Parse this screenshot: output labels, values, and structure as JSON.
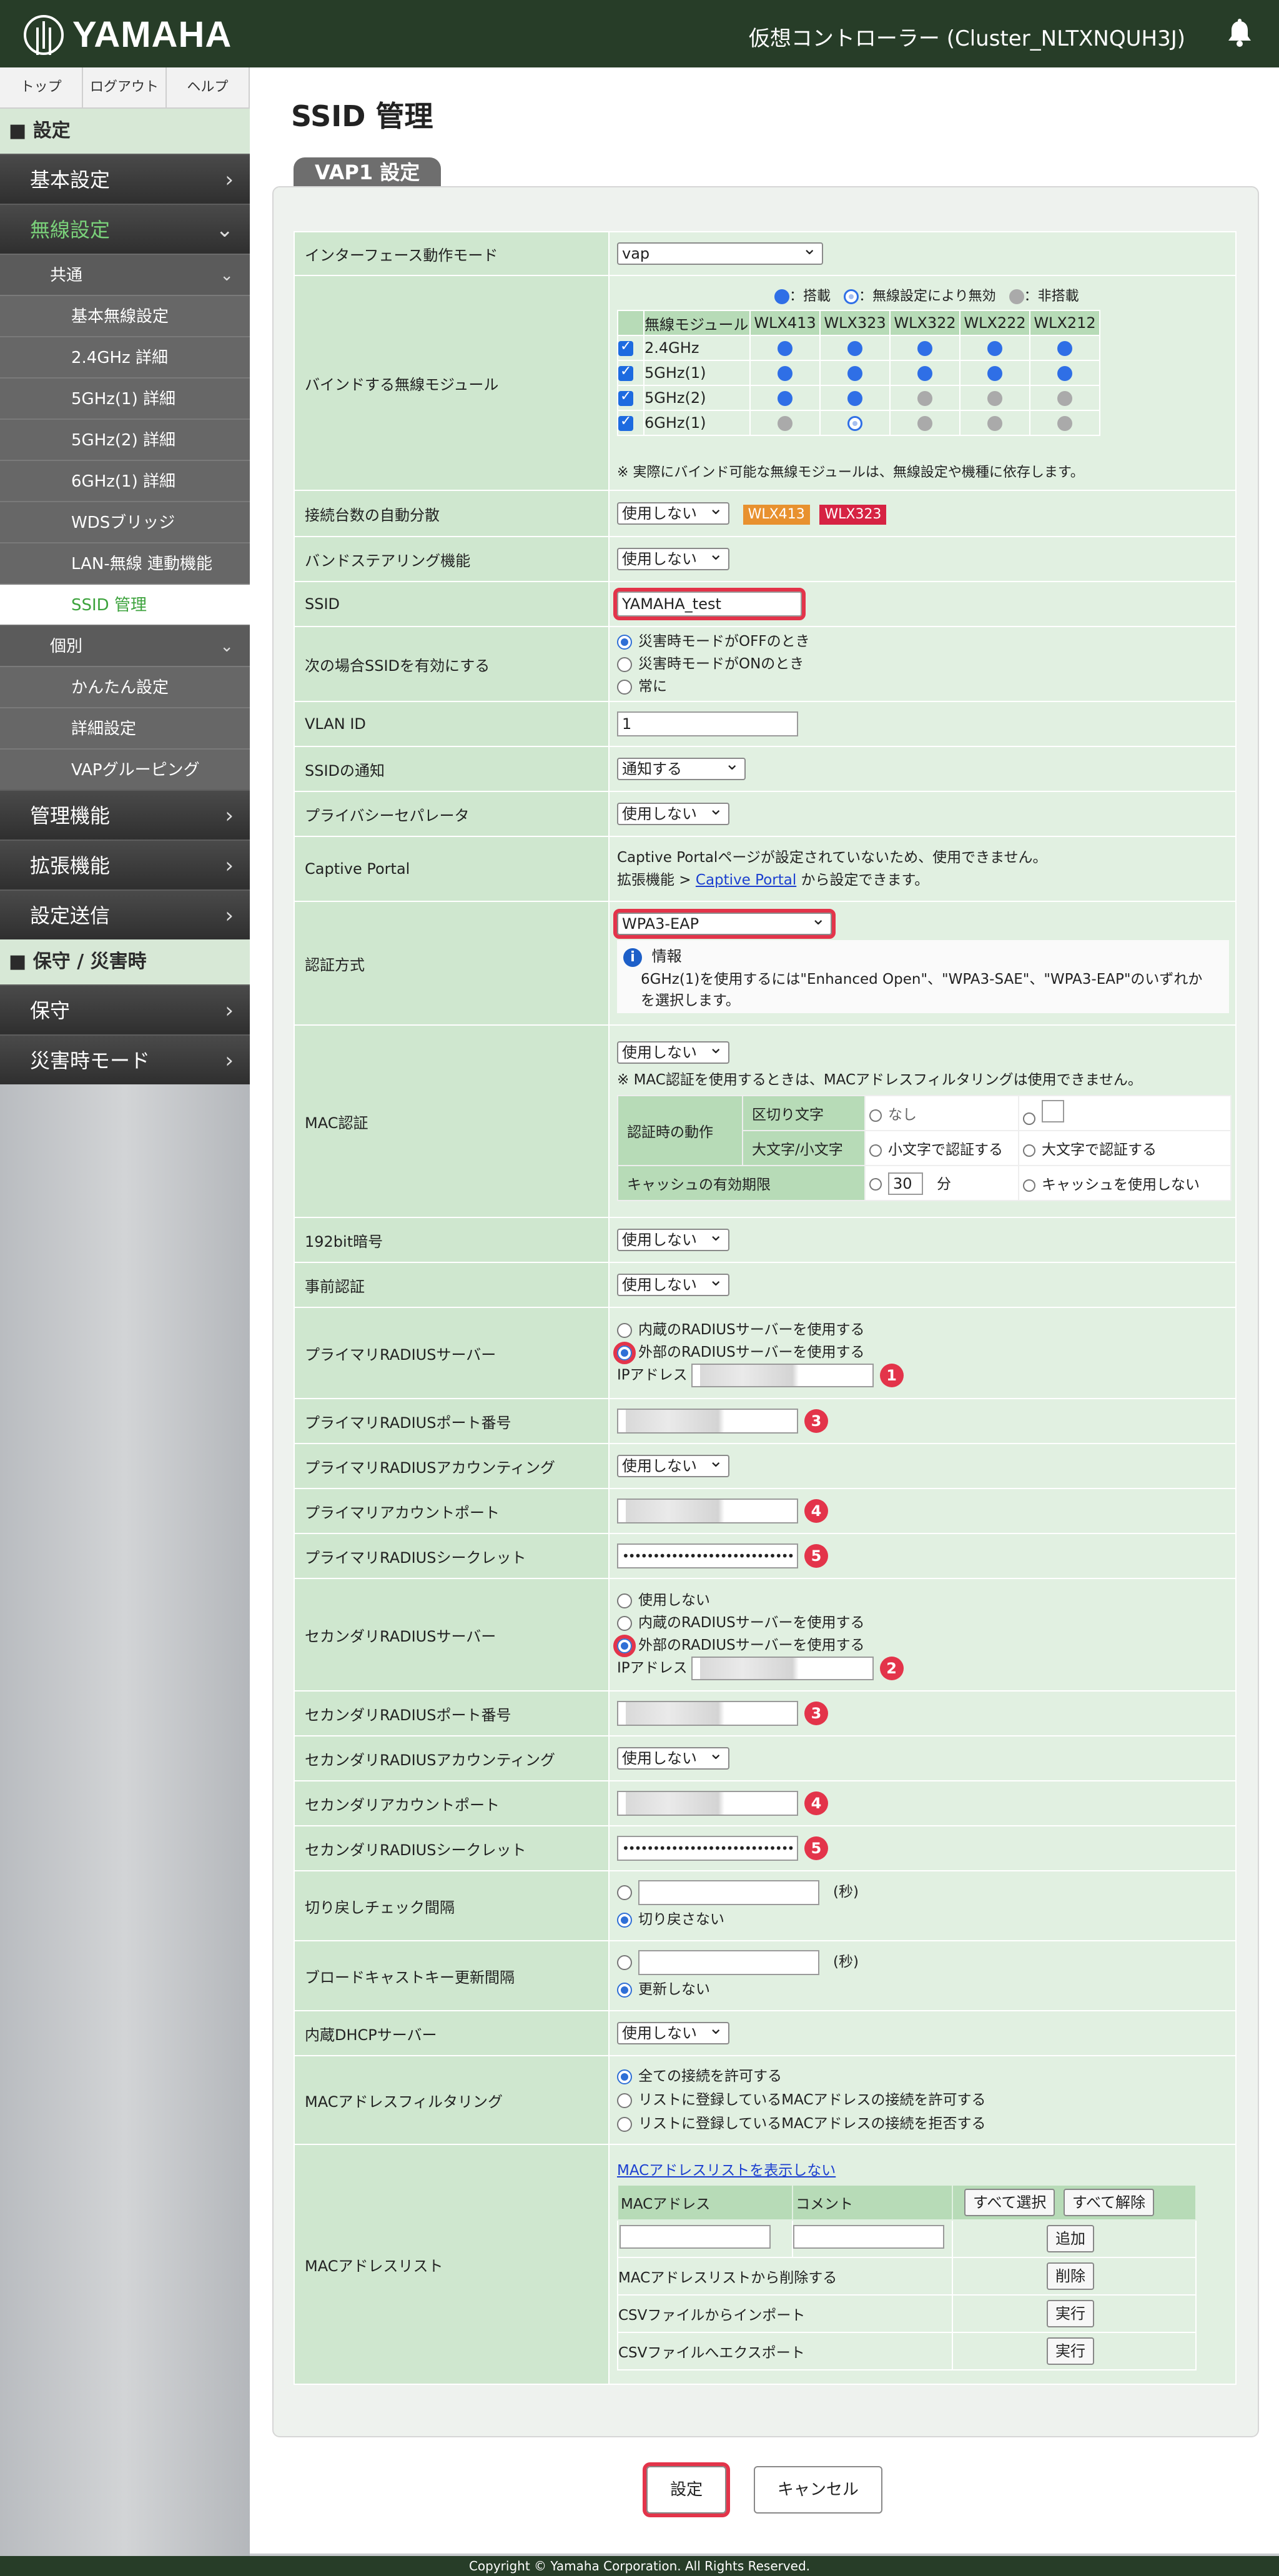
{
  "header": {
    "logo_text": "YAMAHA",
    "controller_title": "仮想コントローラー (Cluster_NLTXNQUH3J)",
    "bell_icon": "bell-icon"
  },
  "sidebar": {
    "top_links": [
      "トップ",
      "ログアウト",
      "ヘルプ"
    ],
    "cat_settings": "設定",
    "basic": "基本設定",
    "wireless": "無線設定",
    "common": "共通",
    "common_items": [
      "基本無線設定",
      "2.4GHz 詳細",
      "5GHz(1) 詳細",
      "5GHz(2) 詳細",
      "6GHz(1) 詳細",
      "WDSブリッジ",
      "LAN-無線 連動機能",
      "SSID 管理"
    ],
    "individual": "個別",
    "individual_items": [
      "かんたん設定",
      "詳細設定",
      "VAPグルーピング"
    ],
    "mgmt": "管理機能",
    "ext": "拡張機能",
    "send": "設定送信",
    "cat_maint": "保守 / 災害時",
    "maint": "保守",
    "disaster": "災害時モード"
  },
  "page": {
    "title": "SSID 管理",
    "tab": "VAP1 設定"
  },
  "form": {
    "iface_mode": {
      "label": "インターフェース動作モード",
      "value": "vap"
    },
    "bind": {
      "label": "バインドする無線モジュール",
      "legend_on": "：搭載",
      "legend_disabled": "：無線設定により無効",
      "legend_off": "：非搭載",
      "col_module": "無線モジュール",
      "models": [
        "WLX413",
        "WLX323",
        "WLX322",
        "WLX222",
        "WLX212"
      ],
      "rows": [
        {
          "name": "2.4GHz",
          "states": [
            "on",
            "on",
            "on",
            "on",
            "on"
          ]
        },
        {
          "name": "5GHz(1)",
          "states": [
            "on",
            "on",
            "on",
            "on",
            "on"
          ]
        },
        {
          "name": "5GHz(2)",
          "states": [
            "on",
            "on",
            "off",
            "off",
            "off"
          ]
        },
        {
          "name": "6GHz(1)",
          "states": [
            "off",
            "disabled",
            "off",
            "off",
            "off"
          ]
        }
      ],
      "note": "※ 実際にバインド可能な無線モジュールは、無線設定や機種に依存します。"
    },
    "auto_dist": {
      "label": "接続台数の自動分散",
      "value": "使用しない",
      "tag1": "WLX413",
      "tag2": "WLX323"
    },
    "band_steer": {
      "label": "バンドステアリング機能",
      "value": "使用しない"
    },
    "ssid": {
      "label": "SSID",
      "value": "YAMAHA_test"
    },
    "ssid_enable": {
      "label": "次の場合SSIDを有効にする",
      "opt1": "災害時モードがOFFのとき",
      "opt2": "災害時モードがONのとき",
      "opt3": "常に"
    },
    "vlan": {
      "label": "VLAN ID",
      "value": "1"
    },
    "ssid_notify": {
      "label": "SSIDの通知",
      "value": "通知する"
    },
    "privacy": {
      "label": "プライバシーセパレータ",
      "value": "使用しない"
    },
    "captive": {
      "label": "Captive Portal",
      "line1": "Captive Portalページが設定されていないため、使用できません。",
      "line2_prefix": "拡張機能 > ",
      "line2_link": "Captive Portal",
      "line2_suffix": " から設定できます。"
    },
    "auth": {
      "label": "認証方式",
      "value": "WPA3-EAP",
      "info_title": "情報",
      "info_text1": "6GHz(1)を使用するには\"Enhanced Open\"、\"WPA3-SAE\"、\"WPA3-EAP\"のいずれか",
      "info_text2": "を選択します。"
    },
    "mac_auth": {
      "label": "MAC認証",
      "value": "使用しない",
      "note": "※ MAC認証を使用するときは、MACアドレスフィルタリングは使用できません。",
      "action_label": "認証時の動作",
      "delim_label": "区切り文字",
      "delim_opt": "なし",
      "case_label": "大文字/小文字",
      "case_opt1": "小文字で認証する",
      "case_opt2": "大文字で認証する",
      "cache_label": "キャッシュの有効期限",
      "cache_value": "30",
      "cache_unit": "分",
      "cache_opt2": "キャッシュを使用しない"
    },
    "bit192": {
      "label": "192bit暗号",
      "value": "使用しない"
    },
    "preauth": {
      "label": "事前認証",
      "value": "使用しない"
    },
    "primary_radius": {
      "label": "プライマリRADIUSサーバー",
      "opt1": "内蔵のRADIUSサーバーを使用する",
      "opt2": "外部のRADIUSサーバーを使用する",
      "ip_label": "IPアドレス",
      "badge": "1"
    },
    "primary_port": {
      "label": "プライマリRADIUSポート番号",
      "badge": "3"
    },
    "primary_acct": {
      "label": "プライマリRADIUSアカウンティング",
      "value": "使用しない"
    },
    "primary_acct_port": {
      "label": "プライマリアカウントポート",
      "badge": "4"
    },
    "primary_secret": {
      "label": "プライマリRADIUSシークレット",
      "value": "••••••••••••••••••••••••••••",
      "badge": "5"
    },
    "secondary_radius": {
      "label": "セカンダリRADIUSサーバー",
      "opt0": "使用しない",
      "opt1": "内蔵のRADIUSサーバーを使用する",
      "opt2": "外部のRADIUSサーバーを使用する",
      "ip_label": "IPアドレス",
      "badge": "2"
    },
    "secondary_port": {
      "label": "セカンダリRADIUSポート番号",
      "badge": "3"
    },
    "secondary_acct": {
      "label": "セカンダリRADIUSアカウンティング",
      "value": "使用しない"
    },
    "secondary_acct_port": {
      "label": "セカンダリアカウントポート",
      "badge": "4"
    },
    "secondary_secret": {
      "label": "セカンダリRADIUSシークレット",
      "value": "••••••••••••••••••••••••••••",
      "badge": "5"
    },
    "fallback": {
      "label": "切り戻しチェック間隔",
      "unit": "(秒)",
      "opt2": "切り戻さない"
    },
    "bcast": {
      "label": "ブロードキャストキー更新間隔",
      "unit": "(秒)",
      "opt2": "更新しない"
    },
    "dhcp": {
      "label": "内蔵DHCPサーバー",
      "value": "使用しない"
    },
    "mac_filter": {
      "label": "MACアドレスフィルタリング",
      "opt1": "全ての接続を許可する",
      "opt2": "リストに登録しているMACアドレスの接続を許可する",
      "opt3": "リストに登録しているMACアドレスの接続を拒否する"
    },
    "mac_list": {
      "label": "MACアドレスリスト",
      "hide_link": "MACアドレスリストを表示しない",
      "col_mac": "MACアドレス",
      "col_comment": "コメント",
      "select_all": "すべて選択",
      "deselect_all": "すべて解除",
      "add": "追加",
      "remove_label": "MACアドレスリストから削除する",
      "remove": "削除",
      "import_label": "CSVファイルからインポート",
      "export_label": "CSVファイルへエクスポート",
      "run": "実行"
    }
  },
  "actions": {
    "apply": "設定",
    "cancel": "キャンセル"
  },
  "footer": {
    "copyright": "Copyright © Yamaha Corporation. All Rights Reserved."
  }
}
